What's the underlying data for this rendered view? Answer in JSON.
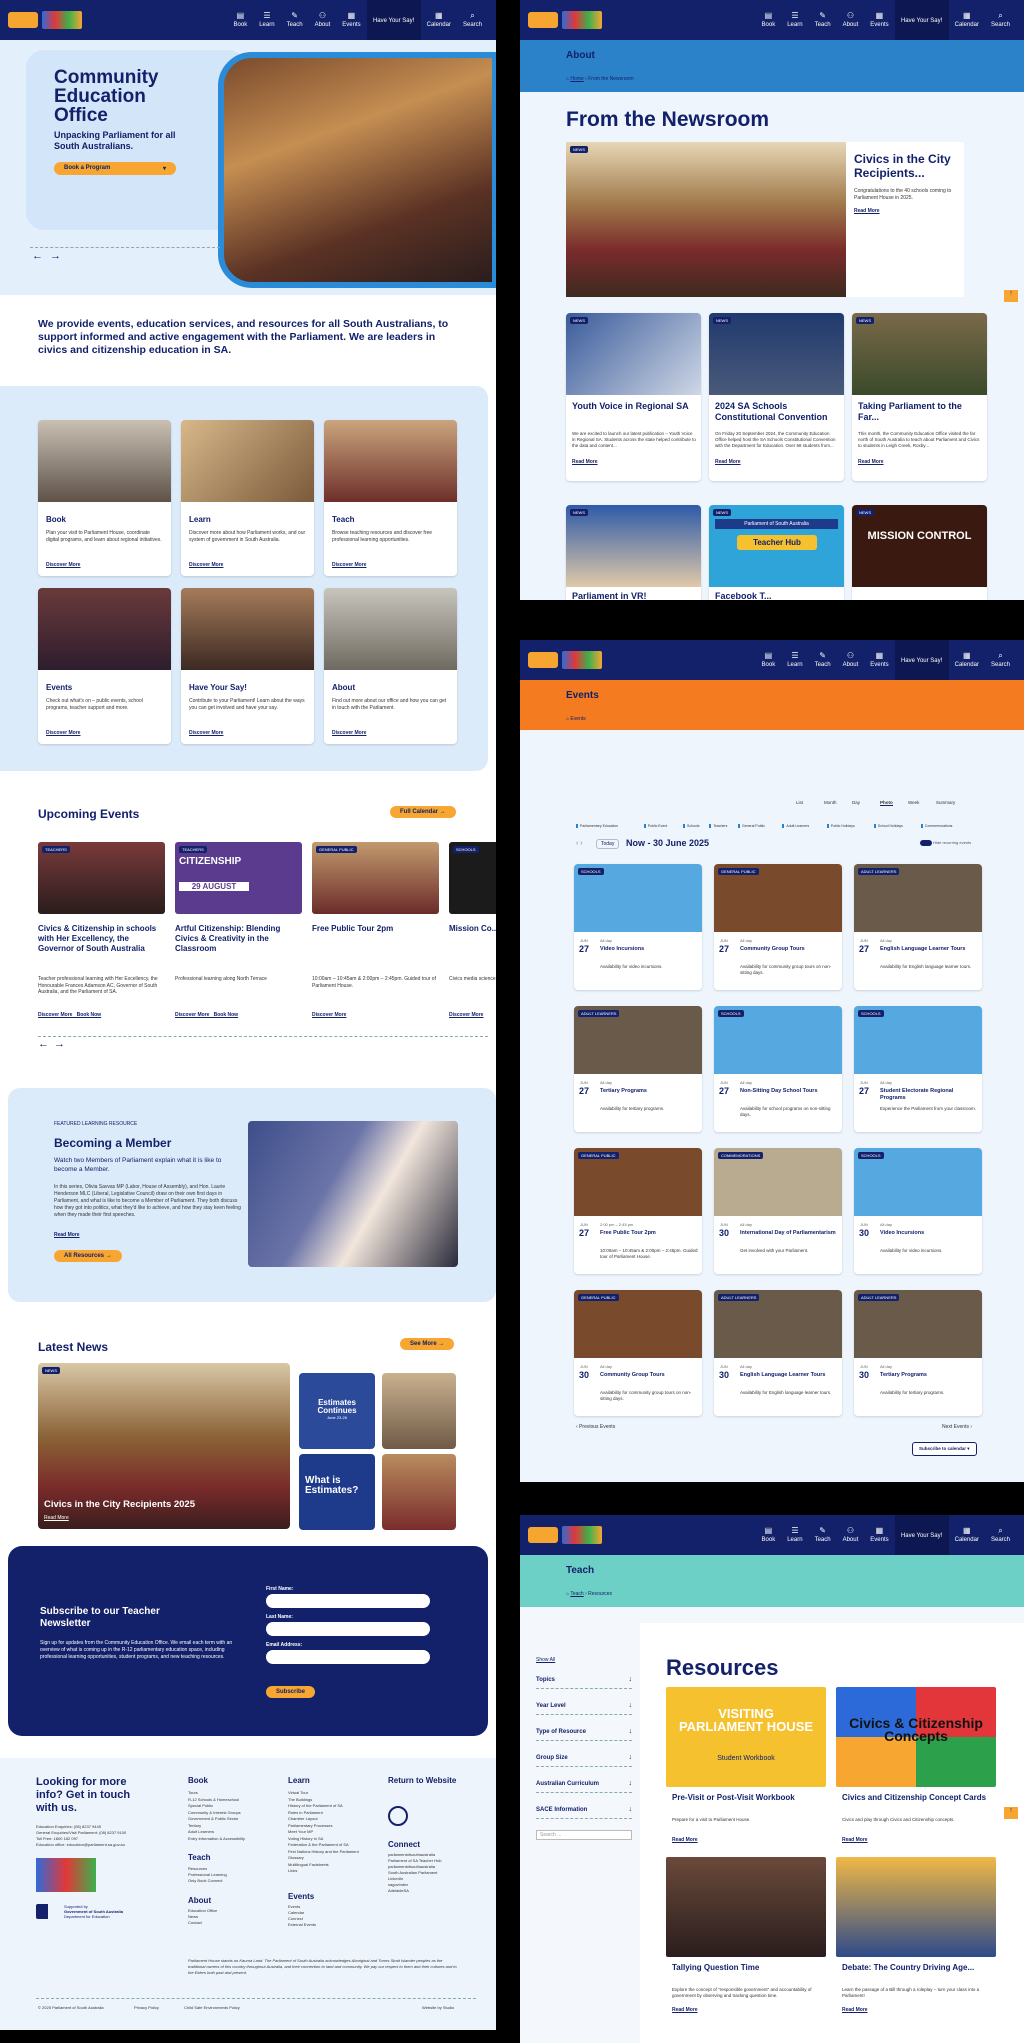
{
  "nav": {
    "items": [
      {
        "label": "Book",
        "icon": "book-icon",
        "glyph": "▤"
      },
      {
        "label": "Learn",
        "icon": "learn-icon",
        "glyph": "☰"
      },
      {
        "label": "Teach",
        "icon": "teach-icon",
        "glyph": "✎"
      },
      {
        "label": "About",
        "icon": "about-icon",
        "glyph": "⚇"
      },
      {
        "label": "Events",
        "icon": "events-icon",
        "glyph": "▦"
      }
    ],
    "say": "Have Your Say!",
    "calendar": "Calendar",
    "search": "Search"
  },
  "home": {
    "hero_title": "Community Education Office",
    "hero_subtitle": "Unpacking Parliament for all South Australians.",
    "hero_button": "Book a Program",
    "intro": "We provide events, education services, and resources for all South Australians, to support informed and active engagement with the Parliament. We are leaders in civics and citizenship education in SA.",
    "tiles": [
      {
        "title": "Book",
        "text": "Plan your visit to Parliament House, coordinate digital programs, and learn about regional initiatives.",
        "link": "Discover More"
      },
      {
        "title": "Learn",
        "text": "Discover more about how Parliament works, and our system of government in South Australia.",
        "link": "Discover More"
      },
      {
        "title": "Teach",
        "text": "Browse teaching resources and discover free professional learning opportunities.",
        "link": "Discover More"
      },
      {
        "title": "Events",
        "text": "Check out what's on – public events, school programs, teacher support and more.",
        "link": "Discover More"
      },
      {
        "title": "Have Your Say!",
        "text": "Contribute to your Parliament! Learn about the ways you can get involved and have your say.",
        "link": "Discover More"
      },
      {
        "title": "About",
        "text": "Find out more about our office and how you can get in touch with the Parliament.",
        "link": "Discover More"
      }
    ],
    "events_title": "Upcoming Events",
    "events_button": "Full Calendar",
    "events": [
      {
        "tag": "TEACHERS",
        "title": "Civics & Citizenship in schools with Her Excellency, the Governor of South Australia",
        "text": "Teacher professional learning with Her Excellency, the Honourable Frances Adamson AC, Governor of South Australia, and the Parliament of SA.",
        "links": "Discover More   Book Now"
      },
      {
        "tag": "TEACHERS",
        "title": "Artful Citizenship: Blending Civics & Creativity in the Classroom",
        "text": "Professional learning along North Terrace",
        "links": "Discover More   Book Now"
      },
      {
        "tag": "GENERAL PUBLIC",
        "title": "Free Public Tour 2pm",
        "text": "10:00am – 10:45am & 2:00pm – 2:45pm. Guided tour of Parliament House.",
        "links": "Discover More"
      },
      {
        "tag": "SCHOOLS",
        "title": "Mission Co...",
        "text": "Civics media science... the Australian Space...",
        "links": "Discover More"
      }
    ],
    "citizenship_poster": "CITIZENSHIP",
    "citizenship_date": "29 AUGUST",
    "feature_kicker": "FEATURED LEARNING RESOURCE",
    "feature_title": "Becoming a Member",
    "feature_lead": "Watch two Members of Parliament explain what it is like to become a Member.",
    "feature_text": "In this series, Olivia Savvas MP (Labor, House of Assembly), and Hon. Laurie Henderson MLC (Liberal, Legislative Council) draw on their own first days in Parliament, and what is like to become a Member of Parliament. They both discuss how they got into politics, what they'd like to achieve, and how they stay keen feeling when they made their first speeches.",
    "feature_link": "Read More",
    "feature_button": "All Resources",
    "news_title": "Latest News",
    "news_button": "See More",
    "news_tag": "NEWS",
    "news_main": "Civics in the City Recipients 2025",
    "news_read": "Read More",
    "news_thumb1": "Estimates Continues",
    "news_thumb1_date": "June 23-26",
    "news_thumb2": "What is Estimates?",
    "subscribe_title": "Subscribe to our Teacher Newsletter",
    "subscribe_text": "Sign up for updates from the Community Education Office. We email each term with an overview of what is coming up in the R-12 parliamentary education space, including professional learning opportunities, student programs, and new teaching resources.",
    "first_name": "First Name:",
    "last_name": "Last Name:",
    "email": "Email Address:",
    "subscribe_button": "Subscribe",
    "footer_title": "Looking for more info? Get in touch with us.",
    "footer_contact": "Education Enquiries: (08) 8237 9445\nGeneral Enquiries/Visit Parliament: (08) 8237 9100\nToll Free: 1800 182 097\nEducation office: education@parliament.sa.gov.au",
    "footer_cols": [
      {
        "head": "Book",
        "items": [
          "Tours",
          "R-12 Schools & Homeschool",
          "Special Public",
          "Community & Interest Groups",
          "Government & Public Sector",
          "Tertiary",
          "Adult Learners",
          "Entry Information & Accessibility"
        ]
      },
      {
        "head": "Learn",
        "items": [
          "Virtual Tour",
          "The Buildings",
          "History of the Parliament of SA",
          "Roles in Parliament",
          "Chamber Layout",
          "Parliamentary Processes",
          "Meet Your MP",
          "Voting History in SA",
          "Federation & the Parliament of SA",
          "First Nations History and the Parliament",
          "Glossary",
          "Multilingual Factsheets",
          "Links"
        ]
      },
      {
        "head": "Return to Website",
        "items": []
      }
    ],
    "footer_teach": "Teach",
    "footer_teach_items": [
      "Resources",
      "Professional Learning",
      "Only Book Connect"
    ],
    "footer_about": "About",
    "footer_about_items": [
      "Education Office",
      "News",
      "Contact"
    ],
    "footer_events": "Events",
    "footer_events_items": [
      "Events",
      "Calendar",
      "Connect",
      "External Events"
    ],
    "connect": "Connect",
    "connect_items": [
      "parliamentofsouthaustralia",
      "Parliament of SA Teacher Hub",
      "parliamentofsouthaustralia",
      "South Australian Parliament",
      "LinkedIn",
      "sagovindex",
      "AdelaideSA"
    ],
    "acknowledgement": "Parliament House stands on Kaurna Land. The Parliament of South Australia acknowledges Aboriginal and Torres Strait Islander peoples as the traditional owners of this country throughout Australia, and their connection to land and community. We pay our respect to them and their cultures and to the Elders both past and present.",
    "supported": "Supported by",
    "gov": "Government of South Australia",
    "dept": "Department for Education",
    "copyright": "© 2025 Parliament of South Australia",
    "privacy": "Privacy Policy",
    "civic": "Child Safe Environments Policy",
    "credit": "Website by Studio"
  },
  "about": {
    "banner": "About",
    "crumb_home": "Home",
    "crumb_here": "From the Newsroom",
    "title": "From the Newsroom",
    "lead_tag": "NEWS",
    "lead_title": "Civics in the City Recipients...",
    "lead_text": "Congratulations to the 40 schools coming to Parliament House in 2025.",
    "lead_link": "Read More",
    "cards": [
      {
        "tag": "NEWS",
        "title": "Youth Voice in Regional SA",
        "text": "We are excited to launch our latest publication – Youth Voice in Regional SA. Students across the state helped contribute to the data and content...",
        "link": "Read More"
      },
      {
        "tag": "NEWS",
        "title": "2024 SA Schools Constitutional Convention",
        "text": "On Friday 20 September 2024, the Community Education Office helped host the SA Schools Constitutional Convention with the Department for Education. Over 68 students from...",
        "link": "Read More"
      },
      {
        "tag": "NEWS",
        "title": "Taking Parliament to the Far...",
        "text": "This month, the Community Education Office visited the far north of South Australia to teach about Parliament and Civics to students in Leigh Creek, Roxby...",
        "link": "Read More"
      }
    ],
    "row3": [
      {
        "tag": "NEWS",
        "title": "Parliament in VR!"
      },
      {
        "tag": "NEWS",
        "title": "Facebook T...",
        "poster_top": "Parliament of South Australia",
        "poster": "Teacher Hub"
      },
      {
        "tag": "NEWS",
        "title": "",
        "poster": "MISSION CONTROL"
      }
    ]
  },
  "events": {
    "banner": "Events",
    "crumb": "Events",
    "views": [
      "List",
      "Month",
      "Day",
      "Photo",
      "Week",
      "Summary"
    ],
    "filters": [
      "Parliamentary Education",
      "Public Event",
      "Schools",
      "Teachers",
      "General Public",
      "Adult Learners",
      "Public Holidays",
      "School Holidays",
      "Commemorations"
    ],
    "today": "Today",
    "range": "Now - 30 June 2025",
    "hide": "Hide recurring events",
    "items": [
      {
        "tag": "SCHOOLS",
        "mon": "JUN",
        "day": "27",
        "time": "All day",
        "title": "Video Incursions",
        "text": "Availability for video incursions."
      },
      {
        "tag": "GENERAL PUBLIC",
        "mon": "JUN",
        "day": "27",
        "time": "All day",
        "title": "Community Group Tours",
        "text": "Availability for community group tours on non-sitting days."
      },
      {
        "tag": "ADULT LEARNERS",
        "mon": "JUN",
        "day": "27",
        "time": "All day",
        "title": "English Language Learner Tours",
        "text": "Availability for English language learner tours."
      },
      {
        "tag": "ADULT LEARNERS",
        "mon": "JUN",
        "day": "27",
        "time": "All day",
        "title": "Tertiary Programs",
        "text": "Availability for tertiary programs."
      },
      {
        "tag": "SCHOOLS",
        "mon": "JUN",
        "day": "27",
        "time": "All day",
        "title": "Non-Sitting Day School Tours",
        "text": "Availability for school programs on non-sitting days."
      },
      {
        "tag": "SCHOOLS",
        "mon": "JUN",
        "day": "27",
        "time": "All day",
        "title": "Student Electorate Regional Programs",
        "text": "Experience the Parliament from your classroom."
      },
      {
        "tag": "GENERAL PUBLIC",
        "mon": "JUN",
        "day": "27",
        "time": "2:00 pm – 2:45 pm",
        "title": "Free Public Tour 2pm",
        "text": "10:00am – 10:45am & 2:00pm – 2:45pm. Guided tour of Parliament House."
      },
      {
        "tag": "COMMEMORATIONS",
        "mon": "JUN",
        "day": "30",
        "time": "All day",
        "title": "International Day of Parliamentarism",
        "text": "Get involved with your Parliament."
      },
      {
        "tag": "SCHOOLS",
        "mon": "JUN",
        "day": "30",
        "time": "All day",
        "title": "Video Incursions",
        "text": "Availability for video incursions."
      },
      {
        "tag": "GENERAL PUBLIC",
        "mon": "JUN",
        "day": "30",
        "time": "All day",
        "title": "Community Group Tours",
        "text": "Availability for community group tours on non-sitting days."
      },
      {
        "tag": "ADULT LEARNERS",
        "mon": "JUN",
        "day": "30",
        "time": "All day",
        "title": "English Language Learner Tours",
        "text": "Availability for English language learner tours."
      },
      {
        "tag": "ADULT LEARNERS",
        "mon": "JUN",
        "day": "30",
        "time": "All day",
        "title": "Tertiary Programs",
        "text": "Availability for tertiary programs."
      }
    ],
    "prev": "Previous Events",
    "next": "Next Events",
    "subscribe": "Subscribe to calendar"
  },
  "teach": {
    "banner": "Teach",
    "crumb_home": "Teach",
    "crumb_here": "Resources",
    "title": "Resources",
    "show_all": "Show All",
    "filters": [
      "Topics",
      "Year Level",
      "Type of Resource",
      "Group Size",
      "Australian Curriculum",
      "SACE Information"
    ],
    "search_placeholder": "Search ...",
    "cards": [
      {
        "title": "Pre-Visit or Post-Visit Workbook",
        "text": "Prepare for a visit to Parliament House.",
        "link": "Read More",
        "poster": "VISITING PARLIAMENT HOUSE",
        "poster_sub": "Student Workbook"
      },
      {
        "title": "Civics and Citizenship Concept Cards",
        "text": "Civics and play through Civics and Citizenship concepts.",
        "link": "Read More",
        "poster": "Civics & Citizenship Concepts"
      },
      {
        "title": "Tallying Question Time",
        "text": "Explore the concept of \"responsible government\" and accountability of government by observing and tracking question time.",
        "link": "Read More"
      },
      {
        "title": "Debate: The Country Driving Age...",
        "text": "Learn the passage of a Bill through a roleplay – turn your class into a Parliament!",
        "link": "Read More"
      }
    ]
  }
}
